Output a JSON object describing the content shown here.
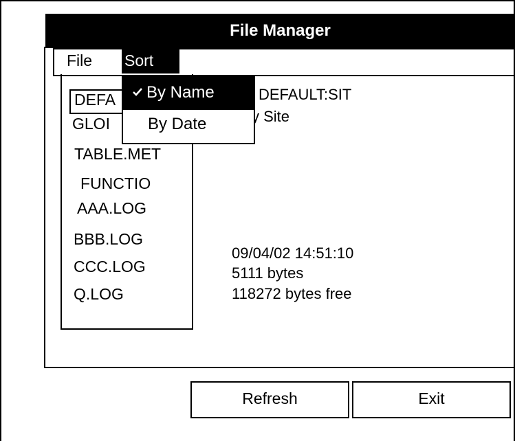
{
  "window": {
    "title": "File Manager"
  },
  "menubar": {
    "file_label": "File",
    "sort_label": "Sort"
  },
  "sort_menu": {
    "items": [
      {
        "label": "By Name",
        "checked": true,
        "icon": "check-icon"
      },
      {
        "label": "By Date",
        "checked": false
      }
    ]
  },
  "file_list": {
    "selected_index": 0,
    "items": [
      {
        "label": "DEFA"
      },
      {
        "label": "GLOI"
      },
      {
        "label": "TABLE.MET"
      },
      {
        "label": "FUNCTIO"
      },
      {
        "label": "AAA.LOG"
      },
      {
        "label": "BBB.LOG"
      },
      {
        "label": "CCC.LOG"
      },
      {
        "label": "Q.LOG"
      }
    ]
  },
  "details": {
    "name": "DEFAULT:SIT",
    "type": "y Site",
    "timestamp": "09/04/02  14:51:10",
    "size": "5111 bytes",
    "free": "118272 bytes free"
  },
  "buttons": {
    "refresh_label": "Refresh",
    "exit_label": "Exit"
  },
  "colors": {
    "foreground": "#000000",
    "background": "#ffffff"
  }
}
